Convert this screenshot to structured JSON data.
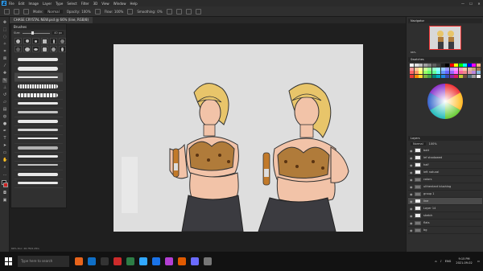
{
  "menubar": {
    "logo": "Ps",
    "items": [
      "File",
      "Edit",
      "Image",
      "Layer",
      "Type",
      "Select",
      "Filter",
      "3D",
      "View",
      "Window",
      "Help"
    ],
    "window_controls": [
      "—",
      "☐",
      "✕"
    ]
  },
  "optionsbar": {
    "mode_label": "Mode:",
    "mode_value": "Normal",
    "opacity_label": "Opacity:",
    "opacity_value": "100%",
    "flow_label": "Flow:",
    "flow_value": "100%",
    "smoothing_label": "Smoothing:",
    "smoothing_value": "0%"
  },
  "tab": {
    "title": "CHASE CRYSTAL NEW.psd @ 66% (line, RGB/8)"
  },
  "brushes_panel": {
    "title": "Brushes",
    "size_label": "Size:",
    "size_value": "40 px"
  },
  "navigator": {
    "title": "Navigator",
    "zoom": "66%"
  },
  "swatches": {
    "title": "Swatches",
    "colors": [
      "#ffffff",
      "#e0e0e0",
      "#c0c0c0",
      "#a0a0a0",
      "#808080",
      "#606060",
      "#404040",
      "#202020",
      "#000000",
      "#ff0000",
      "#ffff00",
      "#00ff00",
      "#00ffff",
      "#0000ff",
      "#ff00ff",
      "#f4b183",
      "#ff9999",
      "#ffcc99",
      "#ffff99",
      "#ccff99",
      "#99ff99",
      "#99ffcc",
      "#99ffff",
      "#99ccff",
      "#9999ff",
      "#cc99ff",
      "#ff99ff",
      "#ff99cc",
      "#f8cbad",
      "#ddb9a0",
      "#c9a27e",
      "#a47a55",
      "#ff6666",
      "#ff9966",
      "#ffff66",
      "#99ff66",
      "#66ff66",
      "#66ff99",
      "#66ffff",
      "#6699ff",
      "#6666ff",
      "#9966ff",
      "#ff66ff",
      "#ff6699",
      "#e88",
      "#d9a",
      "#b8d",
      "#8bd",
      "#e53935",
      "#fb8c00",
      "#fdd835",
      "#7cb342",
      "#43a047",
      "#00897b",
      "#00acc1",
      "#1e88e5",
      "#3949ab",
      "#8e24aa",
      "#d81b60",
      "#c0ca33",
      "#6d4c41",
      "#546e7a",
      "#9e9e9e",
      "#fafafa"
    ]
  },
  "layers_panel": {
    "title": "Layers",
    "blend_mode": "Normal",
    "opacity": "100%",
    "layers": [
      {
        "name": "bott",
        "type": "layer"
      },
      {
        "name": "lef shadowed",
        "type": "layer"
      },
      {
        "name": "half",
        "type": "layer"
      },
      {
        "name": "left natural",
        "type": "layer"
      },
      {
        "name": "colors",
        "type": "folder"
      },
      {
        "name": "ulthentant blushing",
        "type": "folder"
      },
      {
        "name": "group 1",
        "type": "folder"
      },
      {
        "name": "line",
        "type": "layer",
        "selected": true
      },
      {
        "name": "Layer 14",
        "type": "layer"
      },
      {
        "name": "sketch",
        "type": "layer"
      },
      {
        "name": "flats",
        "type": "folder"
      },
      {
        "name": "bg",
        "type": "folder"
      }
    ]
  },
  "statusbar": {
    "text": "66%   Doc: 26.7M/1.05G"
  },
  "taskbar": {
    "search_placeholder": "Type here to search",
    "time": "9:15 PM",
    "date": "2021-09-02",
    "lang": "ENG",
    "apps": [
      "#e8641b",
      "#0f6fc6",
      "#333333",
      "#cc2b2b",
      "#2d7d46",
      "#31a8ff",
      "#1a73e8",
      "#b33fd4",
      "#e05a00",
      "#6b6bff",
      "#777777"
    ]
  }
}
